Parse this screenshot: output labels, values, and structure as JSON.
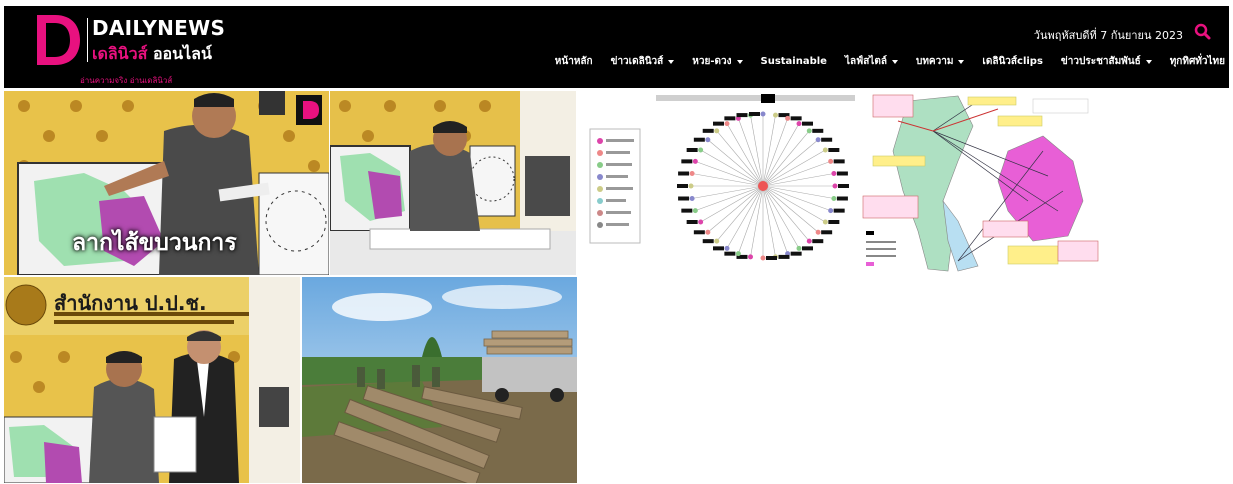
{
  "brand": {
    "letter": "D",
    "name": "DAILYNEWS",
    "sub_pink": "เดลินิวส์",
    "sub_white": "ออนไลน์",
    "tagline": "อ่านความจริง อ่านเดลินิวส์",
    "accent": "#e8117f"
  },
  "header": {
    "date": "วันพฤหัสบดีที่ 7 กันยายน 2023",
    "search_icon": "search-icon"
  },
  "nav": [
    {
      "label": "หน้าหลัก",
      "has_menu": false
    },
    {
      "label": "ข่าวเดลินิวส์",
      "has_menu": true
    },
    {
      "label": "หวย-ดวง",
      "has_menu": true
    },
    {
      "label": "Sustainable",
      "has_menu": false
    },
    {
      "label": "ไลฟ์สไตล์",
      "has_menu": true
    },
    {
      "label": "บทความ",
      "has_menu": true
    },
    {
      "label": "เดลินิวส์clips",
      "has_menu": false
    },
    {
      "label": "ข่าวประชาสัมพันธ์",
      "has_menu": true
    },
    {
      "label": "ทุกทิศทั่วไทย",
      "has_menu": false
    }
  ],
  "gallery": {
    "overlay_title": "ลากไส้ขบวนการ",
    "office_name": "สำนักงาน ป.ป.ช.",
    "photos": [
      {
        "name": "photo-officer-map-presentation"
      },
      {
        "name": "photo-officer-signing"
      },
      {
        "name": "photo-network-diagram"
      },
      {
        "name": "photo-route-map"
      },
      {
        "name": "photo-officials-document"
      },
      {
        "name": "photo-seized-timber"
      }
    ]
  }
}
